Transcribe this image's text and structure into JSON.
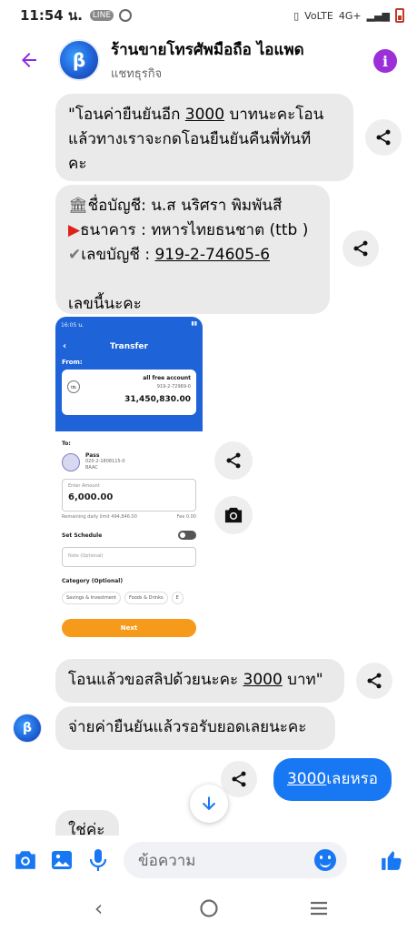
{
  "status_bar": {
    "time": "11:54 น.",
    "network": "4G+"
  },
  "header": {
    "title": "ร้านขายโทรศัพมือถือ ไอแพด",
    "subtitle": "แชทธุรกิจ"
  },
  "messages": [
    {
      "id": "m1",
      "lines": [
        "\"โอนค่ายืนยันอีก ",
        "3000",
        " บาทนะคะโอน",
        "แล้วทางเราจะกดโอนยืนยันคืนพี่ทันที",
        "คะ"
      ]
    },
    {
      "id": "m2",
      "account_name": "ชื่อบัญชี:  น.ส นริศรา พิมพันสี",
      "bank": "ธนาคาร : ทหารไทยธนชาต (ttb )",
      "account_label": "เลขบัญชี : ",
      "account_no": "919-2-74605-6",
      "footer": "เลขนี้นะคะ"
    },
    {
      "id": "m3",
      "prefix": "โอนแล้วขอสลิปด้วยนะคะ ",
      "amount": "3000",
      "suffix": " บาท\""
    },
    {
      "id": "m4",
      "text": "จ่ายค่ายืนยันแล้วรอรับยอดเลยนะคะ"
    },
    {
      "id": "m5_outgoing",
      "amount": "3000",
      "text": "เลยหรอ"
    },
    {
      "id": "m6_partial",
      "text": "ใช่ค่ะ"
    }
  ],
  "transfer_screenshot": {
    "status_time": "16:05 น.",
    "title": "Transfer",
    "from_label": "From:",
    "bank_logo": "ttb",
    "account_type": "all free account",
    "account_no": "919-2-72969-0",
    "balance": "31,450,830.00",
    "to_label": "To:",
    "payee_name": "Pass",
    "payee_account": "020-2-1808115-0",
    "payee_bank": "BAAC",
    "amount_label": "Enter Amount",
    "amount": "6,000.00",
    "daily_limit": "Remaining daily limit 494,846.00",
    "fee": "Fee 0.00",
    "schedule_label": "Set Schedule",
    "note_placeholder": "Note (Optional)",
    "category_label": "Category (Optional)",
    "categories": [
      "Savings & Investment",
      "Foods & Drinks",
      "E"
    ],
    "next_label": "Next"
  },
  "composer": {
    "placeholder": "ข้อความ"
  },
  "icons": {
    "back": "back-arrow-icon",
    "info": "info-icon",
    "share": "share-icon",
    "camera": "camera-icon",
    "gallery": "gallery-icon",
    "mic": "microphone-icon",
    "emoji": "emoji-icon",
    "like": "thumbs-up-icon",
    "scroll_down": "arrow-down-icon"
  },
  "colors": {
    "accent": "#1877f2",
    "header_accent": "#9b30d9",
    "incoming_bubble": "#eaeaea",
    "outgoing_bubble": "#1877f2"
  }
}
